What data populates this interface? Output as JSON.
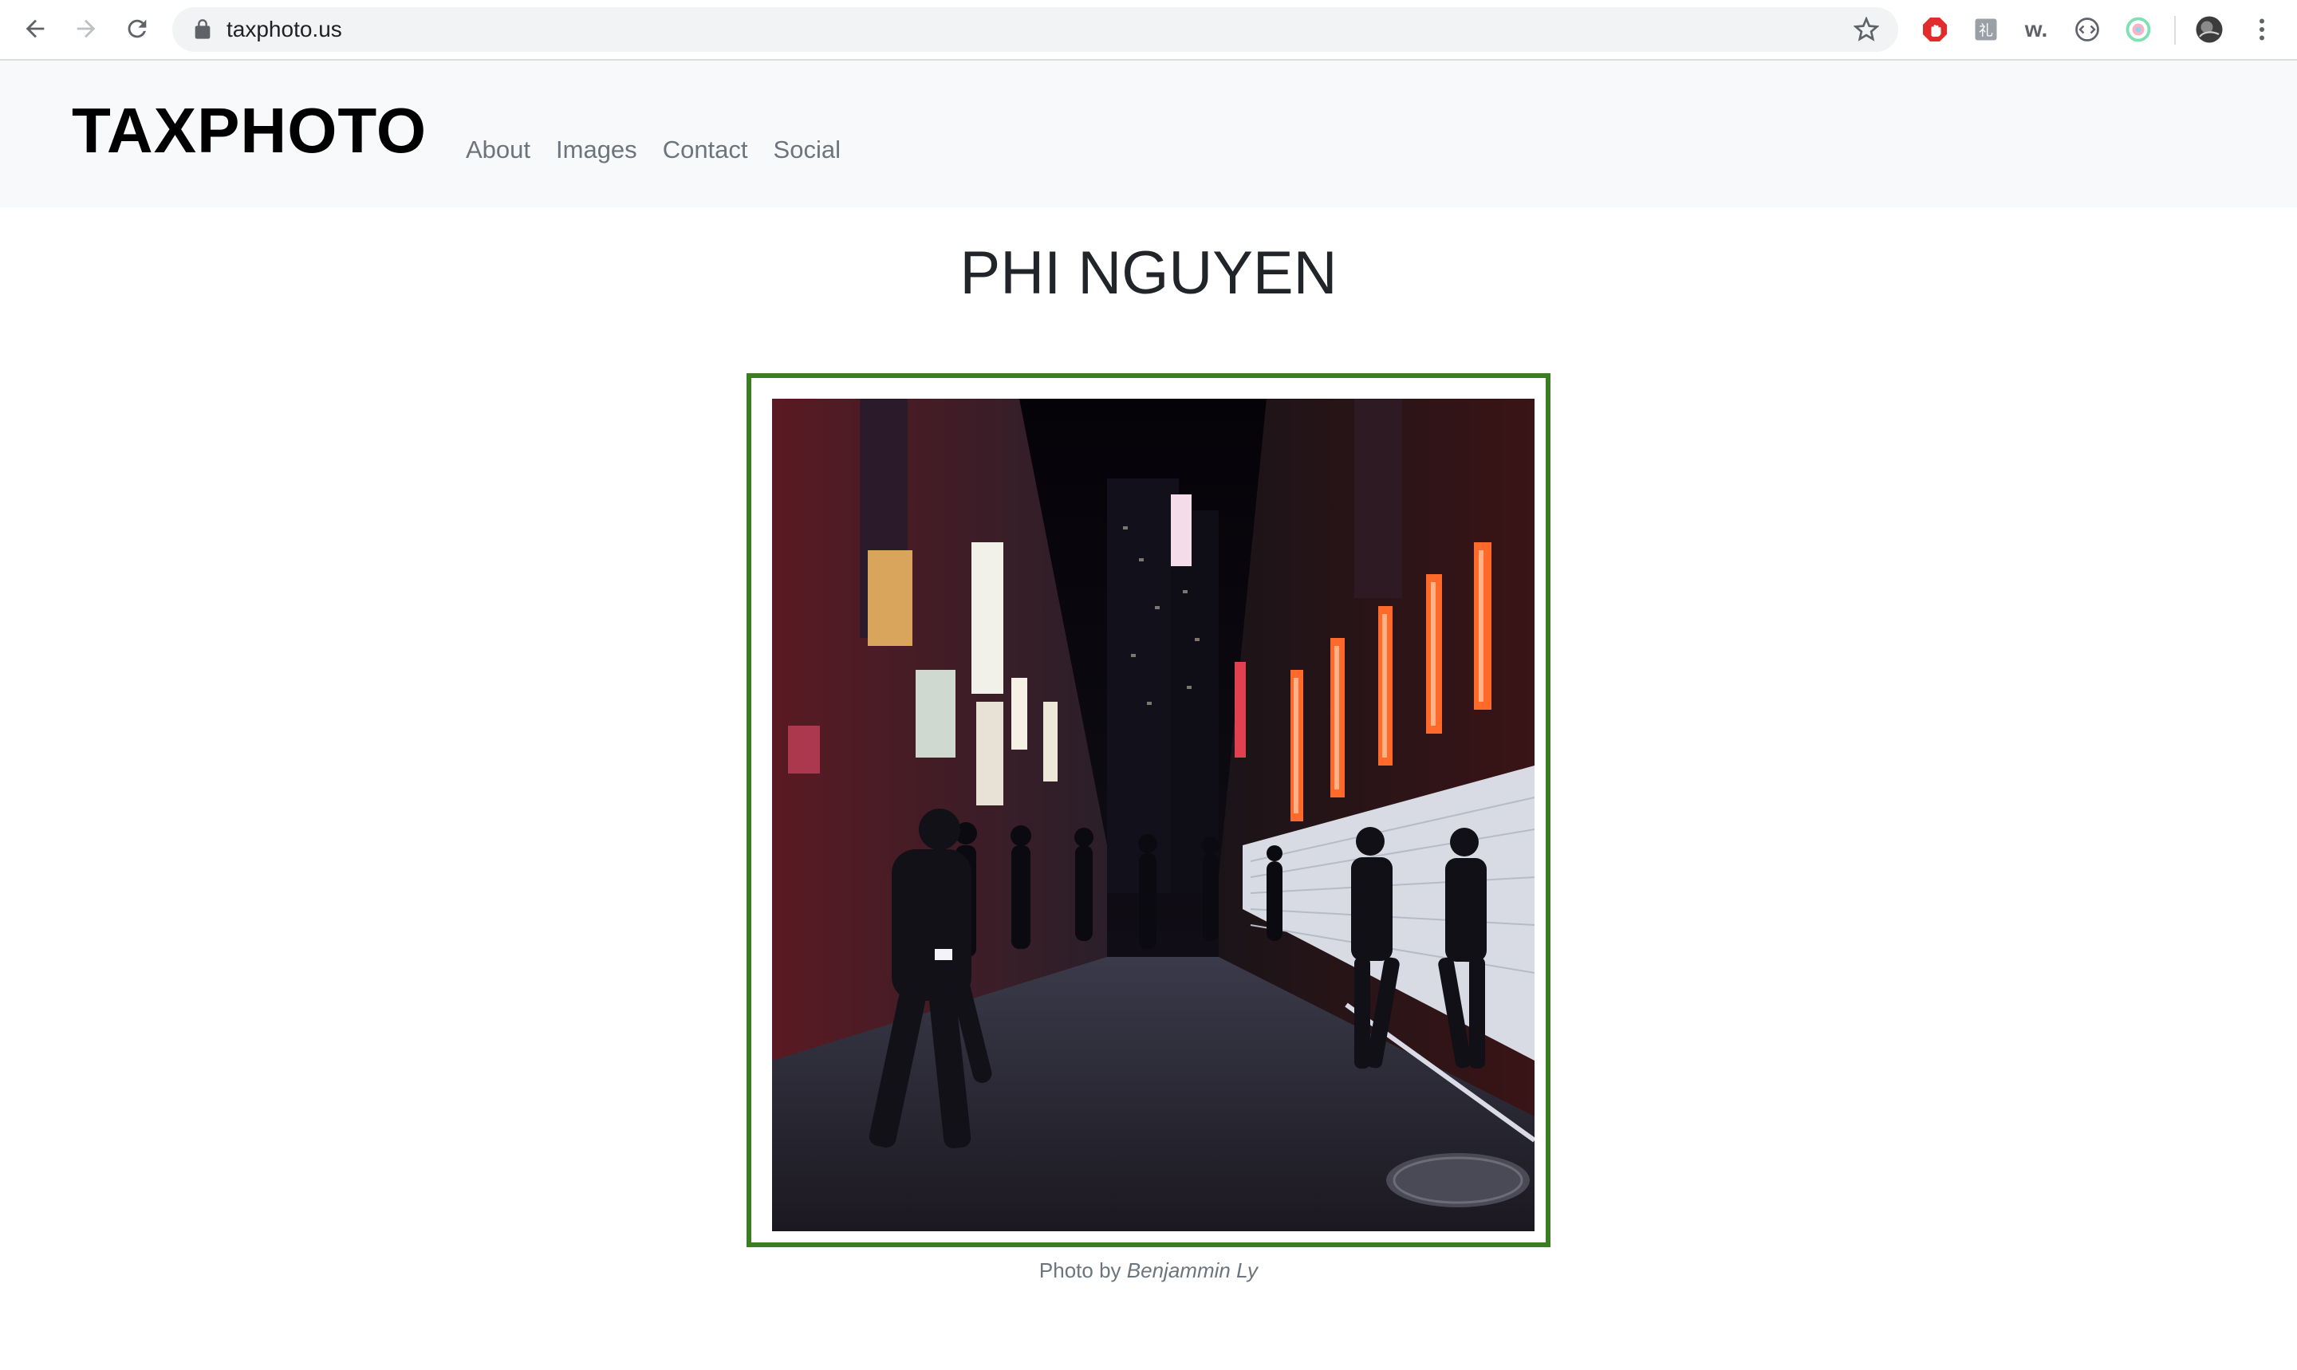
{
  "browser": {
    "url": "taxphoto.us",
    "extensions": [
      "adblock-icon",
      "translate-icon",
      "w-extension-icon",
      "code-extension-icon",
      "color-extension-icon"
    ],
    "w_extension_label": "w."
  },
  "site": {
    "brand": "TAXPHOTO",
    "nav": [
      "About",
      "Images",
      "Contact",
      "Social"
    ]
  },
  "page": {
    "artist_name": "PHI NGUYEN",
    "photo_alt": "Night street scene with neon signs and pedestrians",
    "caption_prefix": "Photo by",
    "caption_author": "Benjammin Ly",
    "frame_color": "#3b7d23"
  }
}
